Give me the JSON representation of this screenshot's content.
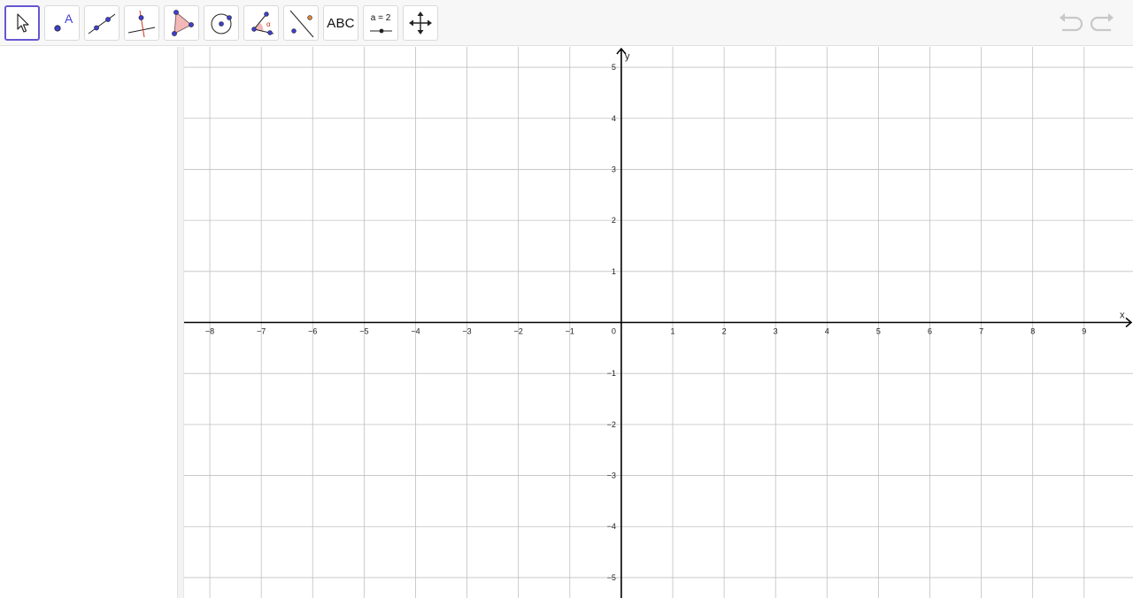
{
  "toolbar": {
    "tools": [
      {
        "name": "move-tool",
        "icon": "cursor-arrow-icon"
      },
      {
        "name": "point-tool",
        "icon": "point-icon",
        "glyph": "A"
      },
      {
        "name": "line-tool",
        "icon": "line-through-points-icon"
      },
      {
        "name": "perpendicular-line-tool",
        "icon": "perpendicular-line-icon"
      },
      {
        "name": "polygon-tool",
        "icon": "polygon-icon"
      },
      {
        "name": "circle-tool",
        "icon": "circle-center-point-icon"
      },
      {
        "name": "angle-tool",
        "icon": "angle-icon",
        "glyph": "α"
      },
      {
        "name": "reflect-tool",
        "icon": "reflect-about-line-icon"
      },
      {
        "name": "text-tool",
        "icon": "text-icon",
        "label": "ABC"
      },
      {
        "name": "slider-tool",
        "icon": "slider-icon",
        "label": "a = 2"
      },
      {
        "name": "move-graphics-tool",
        "icon": "move-graphics-view-icon"
      }
    ],
    "undo": {
      "icon": "undo-icon"
    },
    "redo": {
      "icon": "redo-icon"
    }
  },
  "graph": {
    "x_axis_label": "x",
    "y_axis_label": "y",
    "x_range": [
      -8.5,
      9.95
    ],
    "y_range": [
      -5.4,
      5.4
    ],
    "x_ticks": [
      -8,
      -7,
      -6,
      -5,
      -4,
      -3,
      -2,
      -1,
      1,
      2,
      3,
      4,
      5,
      6,
      7,
      8,
      9
    ],
    "y_ticks": [
      -5,
      -4,
      -3,
      -2,
      -1,
      1,
      2,
      3,
      4,
      5
    ],
    "origin_label": "0",
    "grid": true,
    "colors": {
      "grid": "#c0c0c0",
      "axis": "#000000",
      "accent": "#6557d2"
    }
  }
}
